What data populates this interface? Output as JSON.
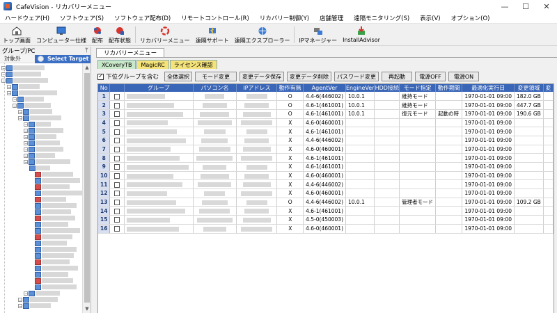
{
  "window": {
    "title": "CafeVision - リカバリーメニュー",
    "minimize": "—",
    "maximize": "☐",
    "close": "✕"
  },
  "menu": [
    "ハードウェア(H)",
    "ソフトウェア(S)",
    "ソフトウェア配布(D)",
    "リモートコントロール(R)",
    "リカバリー制御(Y)",
    "店舗管理",
    "遠隔モニタリング(S)",
    "表示(V)",
    "オプション(O)"
  ],
  "toolbar": {
    "items": [
      {
        "label": "トップ画面",
        "icon": "home-icon"
      },
      {
        "label": "コンピューター仕様",
        "icon": "monitor-icon"
      },
      {
        "label": "配布",
        "icon": "distribute-icon"
      },
      {
        "label": "配布状態",
        "icon": "distribute-status-icon"
      },
      {
        "label": "リカバリーメニュー",
        "icon": "recovery-icon"
      },
      {
        "label": "遠隔サポート",
        "icon": "remote-support-icon"
      },
      {
        "label": "遠隔エクスプローラー",
        "icon": "remote-explorer-icon"
      },
      {
        "label": "IPマネージャー",
        "icon": "ip-manager-icon"
      },
      {
        "label": "InstallAdvisor",
        "icon": "install-advisor-icon"
      }
    ]
  },
  "left": {
    "header": "グループ/PC",
    "pin": "ᛘ",
    "sub_a": "対象外",
    "sub_b": "Select Target"
  },
  "main": {
    "doc_tab": "リカバリーメニュー",
    "subtabs": [
      {
        "label": "XCoveryTB",
        "color": "#c9e7c9"
      },
      {
        "label": "MagicRC",
        "color": "#f4e27a"
      },
      {
        "label": "ライセンス確認",
        "color": "#f4e27a"
      }
    ],
    "include_sub_label": "下位グループを含む",
    "include_sub_checked": "✓",
    "buttons": [
      "全体選択",
      "モード変更",
      "変更データ保存",
      "変更データ削除",
      "パスワード変更",
      "再起動",
      "電源OFF",
      "電源ON"
    ]
  },
  "table": {
    "columns": [
      "No",
      "",
      "グループ",
      "パソコン名",
      "IPアドレス",
      "動作有無",
      "AgentVer",
      "EngineVer",
      "HDD接続",
      "モード指定",
      "動作期間",
      "最適化実行日",
      "変更領域",
      "変"
    ],
    "rows": [
      {
        "no": "1",
        "status": "O",
        "agent": "4.4-6(446002)",
        "engine": "10.0.1",
        "mode": "維持モード",
        "period": "",
        "date": "1970-01-01 09:00",
        "size": "182.0 GB"
      },
      {
        "no": "2",
        "status": "O",
        "agent": "4.6-1(461001)",
        "engine": "10.0.1",
        "mode": "維持モード",
        "period": "",
        "date": "1970-01-01 09:00",
        "size": "447.7 GB"
      },
      {
        "no": "3",
        "status": "O",
        "agent": "4.6-1(461001)",
        "engine": "10.0.1",
        "mode": "復元モード",
        "period": "起動の時",
        "date": "1970-01-01 09:00",
        "size": "190.6 GB"
      },
      {
        "no": "4",
        "status": "X",
        "agent": "4.6-0(460001)",
        "engine": "",
        "mode": "",
        "period": "",
        "date": "1970-01-01 09:00",
        "size": ""
      },
      {
        "no": "5",
        "status": "X",
        "agent": "4.6-1(461001)",
        "engine": "",
        "mode": "",
        "period": "",
        "date": "1970-01-01 09:00",
        "size": ""
      },
      {
        "no": "6",
        "status": "X",
        "agent": "4.4-6(446002)",
        "engine": "",
        "mode": "",
        "period": "",
        "date": "1970-01-01 09:00",
        "size": ""
      },
      {
        "no": "7",
        "status": "X",
        "agent": "4.6-0(460001)",
        "engine": "",
        "mode": "",
        "period": "",
        "date": "1970-01-01 09:00",
        "size": ""
      },
      {
        "no": "8",
        "status": "X",
        "agent": "4.6-1(461001)",
        "engine": "",
        "mode": "",
        "period": "",
        "date": "1970-01-01 09:00",
        "size": ""
      },
      {
        "no": "9",
        "status": "X",
        "agent": "4.6-1(461001)",
        "engine": "",
        "mode": "",
        "period": "",
        "date": "1970-01-01 09:00",
        "size": ""
      },
      {
        "no": "10",
        "status": "X",
        "agent": "4.6-0(460001)",
        "engine": "",
        "mode": "",
        "period": "",
        "date": "1970-01-01 09:00",
        "size": ""
      },
      {
        "no": "11",
        "status": "X",
        "agent": "4.4-6(446002)",
        "engine": "",
        "mode": "",
        "period": "",
        "date": "1970-01-01 09:00",
        "size": ""
      },
      {
        "no": "12",
        "status": "X",
        "agent": "4.6-0(460001)",
        "engine": "",
        "mode": "",
        "period": "",
        "date": "1970-01-01 09:00",
        "size": ""
      },
      {
        "no": "13",
        "status": "O",
        "agent": "4.4-6(446002)",
        "engine": "10.0.1",
        "mode": "管理者モード",
        "period": "",
        "date": "1970-01-01 09:00",
        "size": "109.2 GB"
      },
      {
        "no": "14",
        "status": "X",
        "agent": "4.6-1(461001)",
        "engine": "",
        "mode": "",
        "period": "",
        "date": "1970-01-01 09:00",
        "size": ""
      },
      {
        "no": "15",
        "status": "X",
        "agent": "4.5-0(450003)",
        "engine": "",
        "mode": "",
        "period": "",
        "date": "1970-01-01 09:00",
        "size": ""
      },
      {
        "no": "16",
        "status": "X",
        "agent": "4.6-0(460001)",
        "engine": "",
        "mode": "",
        "period": "",
        "date": "1970-01-01 09:00",
        "size": ""
      }
    ]
  }
}
